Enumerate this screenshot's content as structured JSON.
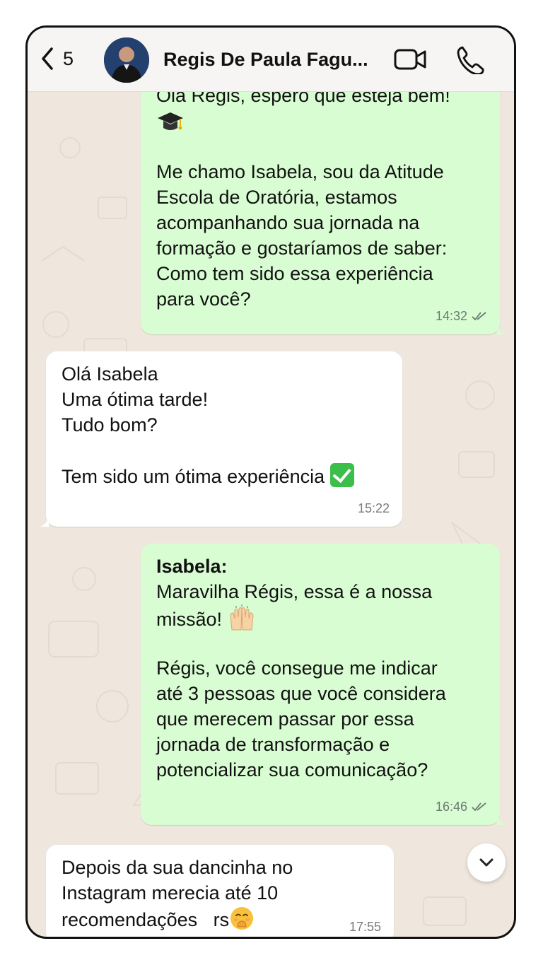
{
  "header": {
    "back_count": "5",
    "contact_name": "Regis De Paula Fagu..."
  },
  "messages": [
    {
      "direction": "outgoing",
      "lines": [
        "Olá Regis, espero que esteja bem!",
        "",
        "",
        "Me chamo Isabela, sou da Atitude",
        "Escola de Oratória, estamos",
        "acompanhando sua jornada na",
        "formação e gostaríamos de saber:",
        "Como tem sido essa experiência",
        "para você?"
      ],
      "emoji": "graduation-cap-emoji",
      "time": "14:32",
      "status": "read"
    },
    {
      "direction": "incoming",
      "lines": [
        "Olá Isabela",
        "Uma ótima tarde!",
        "Tudo bom?",
        "",
        "Tem sido um ótima experiência"
      ],
      "emoji": "check-mark-emoji",
      "time": "15:22"
    },
    {
      "direction": "outgoing",
      "sender": "Isabela:",
      "lines": [
        "Maravilha Régis, essa é a nossa",
        "missão!",
        "",
        "Régis, você consegue me indicar",
        "até 3 pessoas que você considera",
        "que merecem passar por essa",
        "jornada de transformação e",
        "potencializar sua comunicação?"
      ],
      "emoji": "raising-hands-emoji",
      "time": "16:46",
      "status": "read"
    },
    {
      "direction": "incoming",
      "lines": [
        "Depois da sua dancinha no",
        "Instagram merecia até 10",
        "recomendações   rs"
      ],
      "emoji": "hand-over-mouth-emoji",
      "time": "17:55"
    }
  ],
  "colors": {
    "outgoing_bubble": "#d9fdd3",
    "incoming_bubble": "#ffffff",
    "chat_background": "#efe7dd"
  }
}
